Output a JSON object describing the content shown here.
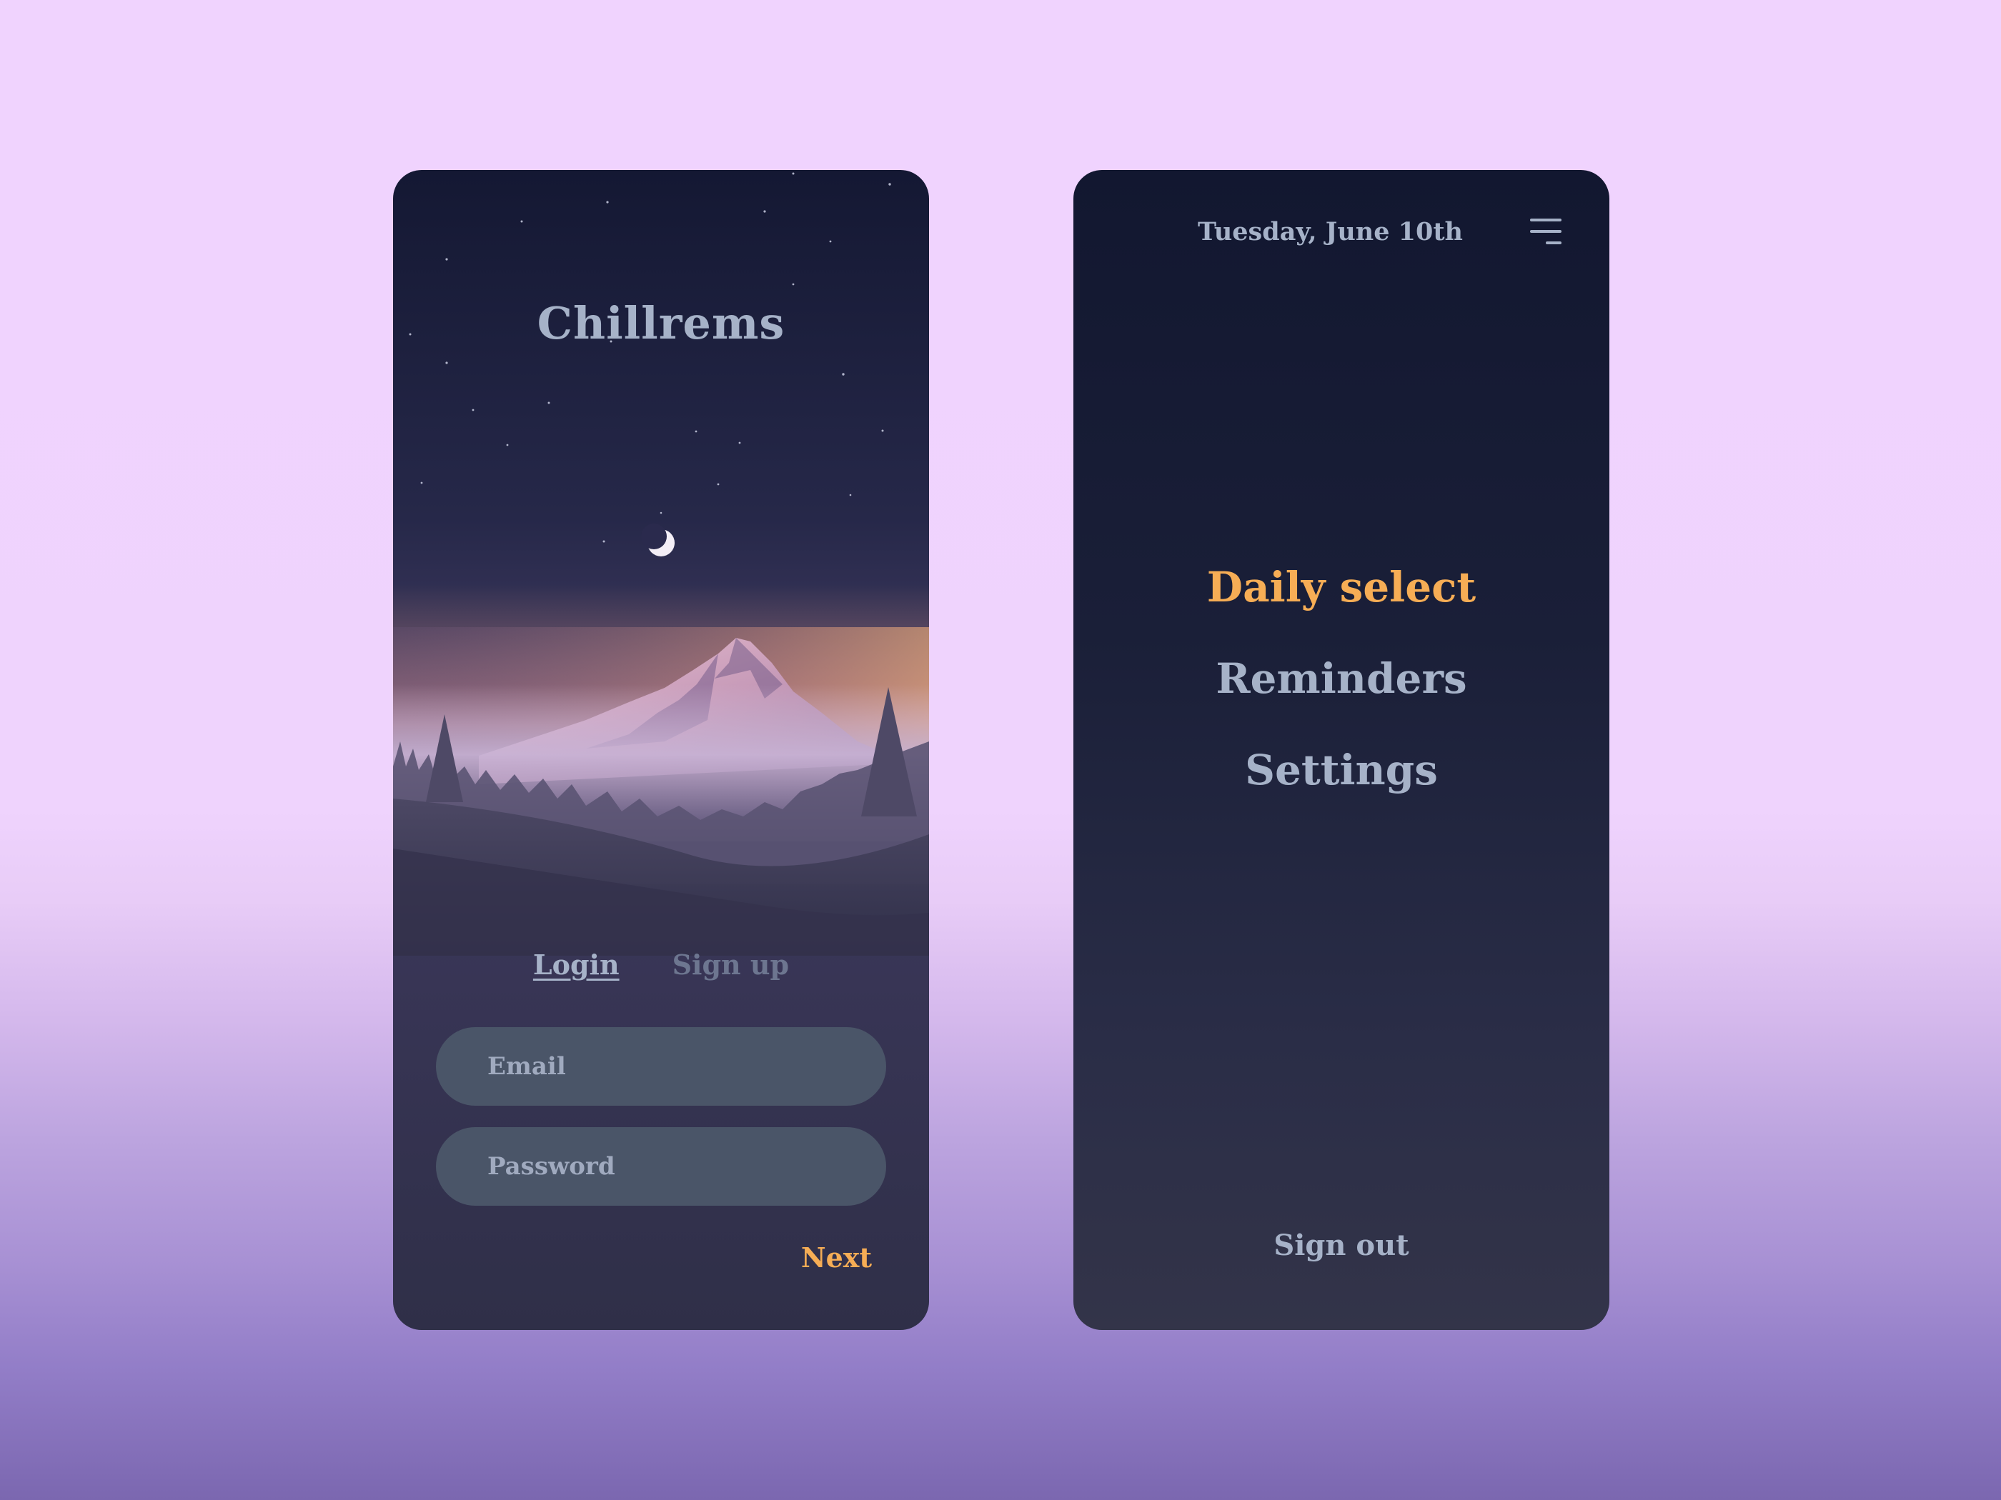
{
  "colors": {
    "background_top": "#f0d3fe",
    "background_bottom": "#7b67b0",
    "accent": "#f6ad55",
    "text": "#a6b2c8",
    "muted_text": "#6d7690",
    "input_fill": "#4a5568"
  },
  "login_screen": {
    "app_title": "Chillrems",
    "tabs": [
      {
        "label": "Login",
        "active": true
      },
      {
        "label": "Sign up",
        "active": false
      }
    ],
    "email": {
      "placeholder": "Email",
      "value": ""
    },
    "password": {
      "placeholder": "Password",
      "value": ""
    },
    "next_label": "Next",
    "illustration": "night-mountain-landscape"
  },
  "menu_screen": {
    "date": "Tuesday, June 10th",
    "menu_icon": "hamburger-icon",
    "items": [
      {
        "label": "Daily select",
        "active": true
      },
      {
        "label": "Reminders",
        "active": false
      },
      {
        "label": "Settings",
        "active": false
      }
    ],
    "sign_out_label": "Sign out"
  }
}
